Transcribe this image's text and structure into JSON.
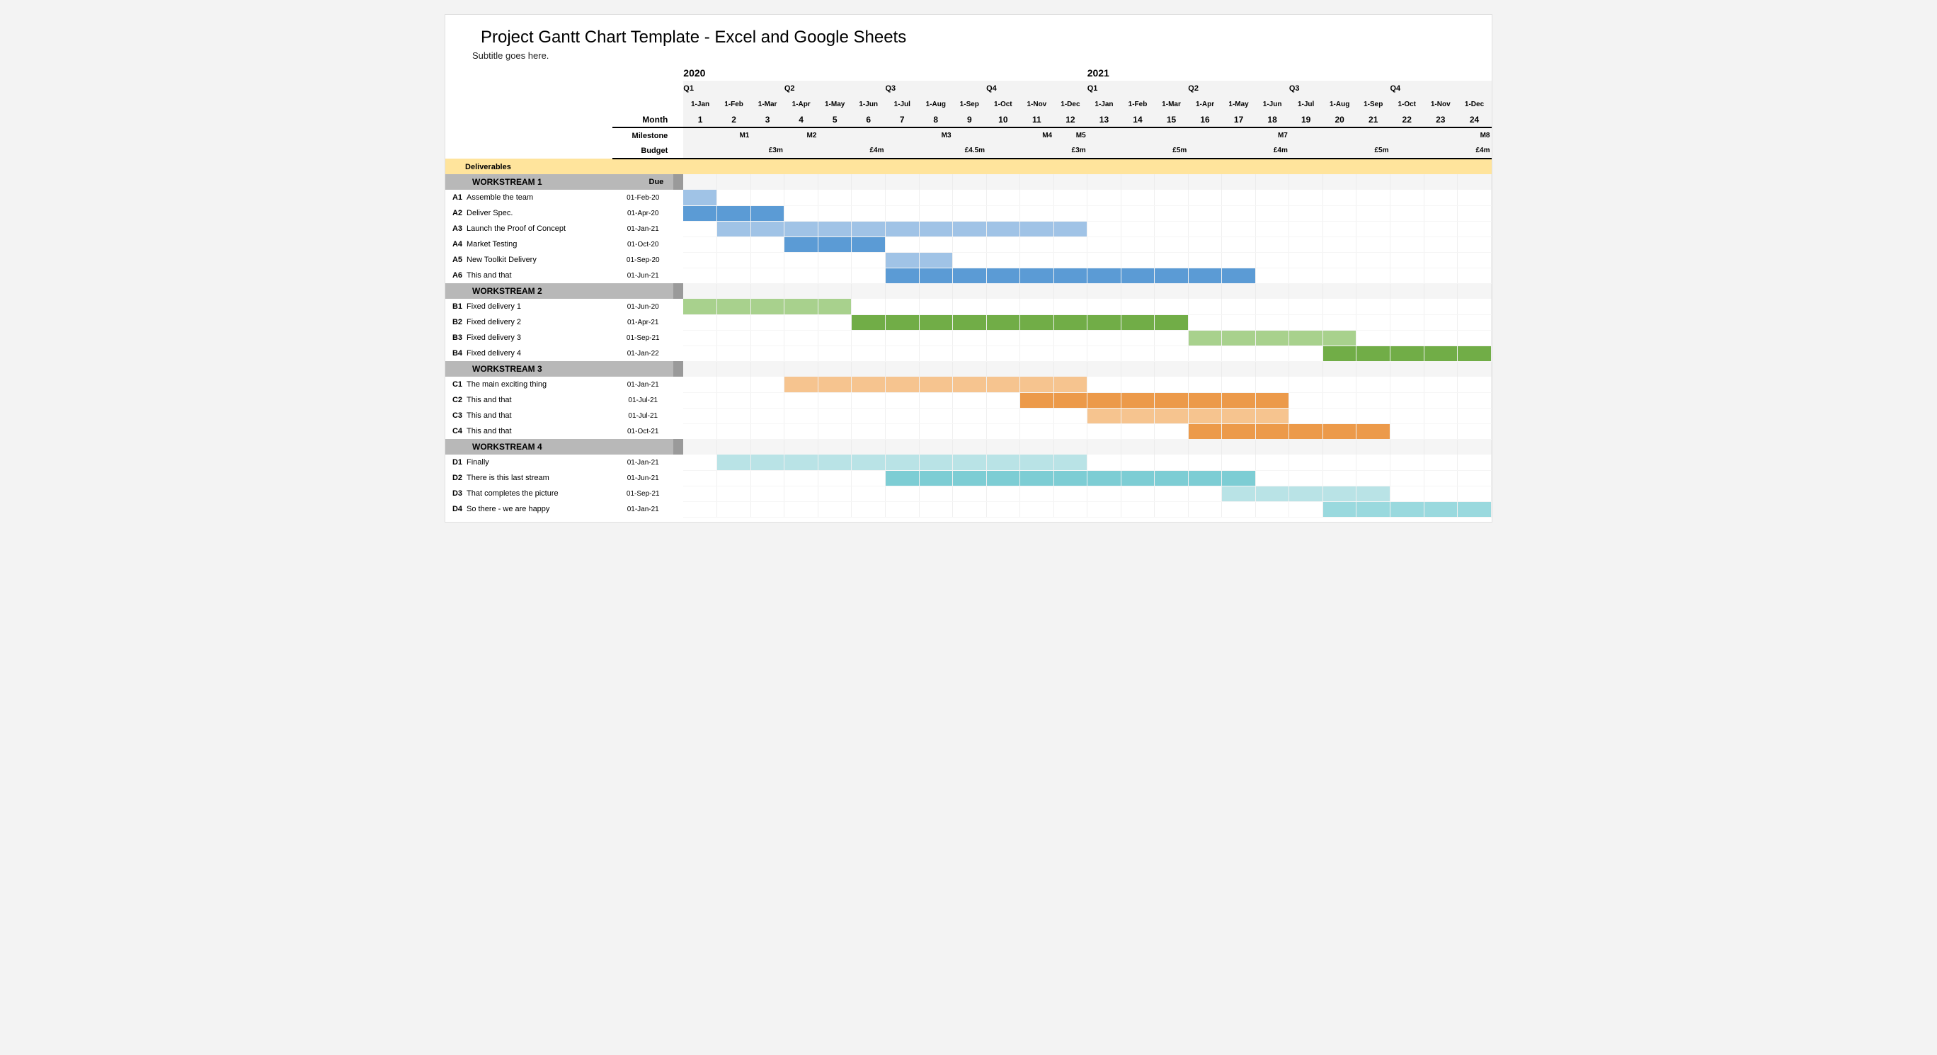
{
  "title": "Project Gantt Chart Template - Excel and Google Sheets",
  "subtitle": "Subtitle goes here.",
  "header": {
    "years": [
      "2020",
      "2021"
    ],
    "quarters": [
      "Q1",
      "Q2",
      "Q3",
      "Q4",
      "Q1",
      "Q2",
      "Q3",
      "Q4"
    ],
    "dates": [
      "1-Jan",
      "1-Feb",
      "1-Mar",
      "1-Apr",
      "1-May",
      "1-Jun",
      "1-Jul",
      "1-Aug",
      "1-Sep",
      "1-Oct",
      "1-Nov",
      "1-Dec",
      "1-Jan",
      "1-Feb",
      "1-Mar",
      "1-Apr",
      "1-May",
      "1-Jun",
      "1-Jul",
      "1-Aug",
      "1-Sep",
      "1-Oct",
      "1-Nov",
      "1-Dec"
    ],
    "monthRowLabel": "Month",
    "monthNums": [
      "1",
      "2",
      "3",
      "4",
      "5",
      "6",
      "7",
      "8",
      "9",
      "10",
      "11",
      "12",
      "13",
      "14",
      "15",
      "16",
      "17",
      "18",
      "19",
      "20",
      "21",
      "22",
      "23",
      "24"
    ],
    "milestoneLabel": "Milestone",
    "milestones": [
      "",
      "M1",
      "",
      "M2",
      "",
      "",
      "",
      "M3",
      "",
      "",
      "M4",
      "M5",
      "",
      "",
      "",
      "",
      "",
      "M7",
      "",
      "",
      "",
      "",
      "",
      "M8"
    ],
    "budgetLabel": "Budget",
    "budgets": [
      "",
      "",
      "£3m",
      "",
      "",
      "£4m",
      "",
      "",
      "£4.5m",
      "",
      "",
      "£3m",
      "",
      "",
      "£5m",
      "",
      "",
      "£4m",
      "",
      "",
      "£5m",
      "",
      "",
      "£4m"
    ],
    "deliverables": "Deliverables",
    "dueHeader": "Due"
  },
  "workstreams": [
    {
      "name": "WORKSTREAM 1",
      "color": "blue",
      "tasks": [
        {
          "id": "A1",
          "name": "Assemble the team",
          "due": "01-Feb-20",
          "start": 1,
          "end": 1,
          "shade": "b-blue-lt"
        },
        {
          "id": "A2",
          "name": "Deliver Spec.",
          "due": "01-Apr-20",
          "start": 1,
          "end": 3,
          "shade": "b-blue"
        },
        {
          "id": "A3",
          "name": "Launch the Proof of Concept",
          "due": "01-Jan-21",
          "start": 2,
          "end": 12,
          "shade": "b-blue-lt"
        },
        {
          "id": "A4",
          "name": "Market Testing",
          "due": "01-Oct-20",
          "start": 4,
          "end": 6,
          "shade": "b-blue"
        },
        {
          "id": "A5",
          "name": "New Toolkit Delivery",
          "due": "01-Sep-20",
          "start": 7,
          "end": 8,
          "shade": "b-blue-lt"
        },
        {
          "id": "A6",
          "name": "This and that",
          "due": "01-Jun-21",
          "start": 7,
          "end": 17,
          "shade": "b-blue"
        }
      ]
    },
    {
      "name": "WORKSTREAM 2",
      "color": "green",
      "tasks": [
        {
          "id": "B1",
          "name": "Fixed delivery 1",
          "due": "01-Jun-20",
          "start": 1,
          "end": 5,
          "shade": "b-green-lt"
        },
        {
          "id": "B2",
          "name": "Fixed delivery 2",
          "due": "01-Apr-21",
          "start": 6,
          "end": 15,
          "shade": "b-green"
        },
        {
          "id": "B3",
          "name": "Fixed delivery 3",
          "due": "01-Sep-21",
          "start": 16,
          "end": 20,
          "shade": "b-green-lt"
        },
        {
          "id": "B4",
          "name": "Fixed delivery 4",
          "due": "01-Jan-22",
          "start": 20,
          "end": 24,
          "shade": "b-green"
        }
      ]
    },
    {
      "name": "WORKSTREAM 3",
      "color": "orange",
      "tasks": [
        {
          "id": "C1",
          "name": "The main exciting thing",
          "due": "01-Jan-21",
          "start": 4,
          "end": 12,
          "shade": "b-orange-lt"
        },
        {
          "id": "C2",
          "name": "This and that",
          "due": "01-Jul-21",
          "start": 11,
          "end": 18,
          "shade": "b-orange"
        },
        {
          "id": "C3",
          "name": "This and that",
          "due": "01-Jul-21",
          "start": 13,
          "end": 18,
          "shade": "b-orange-lt"
        },
        {
          "id": "C4",
          "name": "This and that",
          "due": "01-Oct-21",
          "start": 16,
          "end": 21,
          "shade": "b-orange"
        }
      ]
    },
    {
      "name": "WORKSTREAM 4",
      "color": "teal",
      "tasks": [
        {
          "id": "D1",
          "name": "Finally",
          "due": "01-Jan-21",
          "start": 2,
          "end": 12,
          "shade": "b-teal-lt"
        },
        {
          "id": "D2",
          "name": "There is this last stream",
          "due": "01-Jun-21",
          "start": 7,
          "end": 17,
          "shade": "b-teal"
        },
        {
          "id": "D3",
          "name": "That completes the picture",
          "due": "01-Sep-21",
          "start": 17,
          "end": 21,
          "shade": "b-teal-lt"
        },
        {
          "id": "D4",
          "name": "So there - we are happy",
          "due": "01-Jan-21",
          "start": 20,
          "end": 24,
          "shade": "b-teal-md"
        }
      ]
    }
  ],
  "chart_data": {
    "type": "bar",
    "title": "Project Gantt Chart Template - Excel and Google Sheets",
    "xlabel": "Month",
    "ylabel": "",
    "x_categories": [
      "1-Jan-20",
      "1-Feb-20",
      "1-Mar-20",
      "1-Apr-20",
      "1-May-20",
      "1-Jun-20",
      "1-Jul-20",
      "1-Aug-20",
      "1-Sep-20",
      "1-Oct-20",
      "1-Nov-20",
      "1-Dec-20",
      "1-Jan-21",
      "1-Feb-21",
      "1-Mar-21",
      "1-Apr-21",
      "1-May-21",
      "1-Jun-21",
      "1-Jul-21",
      "1-Aug-21",
      "1-Sep-21",
      "1-Oct-21",
      "1-Nov-21",
      "1-Dec-21"
    ],
    "milestones": {
      "2": "M1",
      "4": "M2",
      "8": "M3",
      "11": "M4",
      "12": "M5",
      "18": "M7",
      "24": "M8"
    },
    "budget": {
      "3": "£3m",
      "6": "£4m",
      "9": "£4.5m",
      "12": "£3m",
      "15": "£5m",
      "18": "£4m",
      "21": "£5m",
      "24": "£4m"
    },
    "series": [
      {
        "group": "WORKSTREAM 1",
        "id": "A1",
        "name": "Assemble the team",
        "due": "01-Feb-20",
        "start": 1,
        "end": 1
      },
      {
        "group": "WORKSTREAM 1",
        "id": "A2",
        "name": "Deliver Spec.",
        "due": "01-Apr-20",
        "start": 1,
        "end": 3
      },
      {
        "group": "WORKSTREAM 1",
        "id": "A3",
        "name": "Launch the Proof of Concept",
        "due": "01-Jan-21",
        "start": 2,
        "end": 12
      },
      {
        "group": "WORKSTREAM 1",
        "id": "A4",
        "name": "Market Testing",
        "due": "01-Oct-20",
        "start": 4,
        "end": 6
      },
      {
        "group": "WORKSTREAM 1",
        "id": "A5",
        "name": "New Toolkit Delivery",
        "due": "01-Sep-20",
        "start": 7,
        "end": 8
      },
      {
        "group": "WORKSTREAM 1",
        "id": "A6",
        "name": "This and that",
        "due": "01-Jun-21",
        "start": 7,
        "end": 17
      },
      {
        "group": "WORKSTREAM 2",
        "id": "B1",
        "name": "Fixed delivery 1",
        "due": "01-Jun-20",
        "start": 1,
        "end": 5
      },
      {
        "group": "WORKSTREAM 2",
        "id": "B2",
        "name": "Fixed delivery 2",
        "due": "01-Apr-21",
        "start": 6,
        "end": 15
      },
      {
        "group": "WORKSTREAM 2",
        "id": "B3",
        "name": "Fixed delivery 3",
        "due": "01-Sep-21",
        "start": 16,
        "end": 20
      },
      {
        "group": "WORKSTREAM 2",
        "id": "B4",
        "name": "Fixed delivery 4",
        "due": "01-Jan-22",
        "start": 20,
        "end": 24
      },
      {
        "group": "WORKSTREAM 3",
        "id": "C1",
        "name": "The main exciting thing",
        "due": "01-Jan-21",
        "start": 4,
        "end": 12
      },
      {
        "group": "WORKSTREAM 3",
        "id": "C2",
        "name": "This and that",
        "due": "01-Jul-21",
        "start": 11,
        "end": 18
      },
      {
        "group": "WORKSTREAM 3",
        "id": "C3",
        "name": "This and that",
        "due": "01-Jul-21",
        "start": 13,
        "end": 18
      },
      {
        "group": "WORKSTREAM 3",
        "id": "C4",
        "name": "This and that",
        "due": "01-Oct-21",
        "start": 16,
        "end": 21
      },
      {
        "group": "WORKSTREAM 4",
        "id": "D1",
        "name": "Finally",
        "due": "01-Jan-21",
        "start": 2,
        "end": 12
      },
      {
        "group": "WORKSTREAM 4",
        "id": "D2",
        "name": "There is this last stream",
        "due": "01-Jun-21",
        "start": 7,
        "end": 17
      },
      {
        "group": "WORKSTREAM 4",
        "id": "D3",
        "name": "That completes the picture",
        "due": "01-Sep-21",
        "start": 17,
        "end": 21
      },
      {
        "group": "WORKSTREAM 4",
        "id": "D4",
        "name": "So there - we are happy",
        "due": "01-Jan-21",
        "start": 20,
        "end": 24
      }
    ]
  }
}
